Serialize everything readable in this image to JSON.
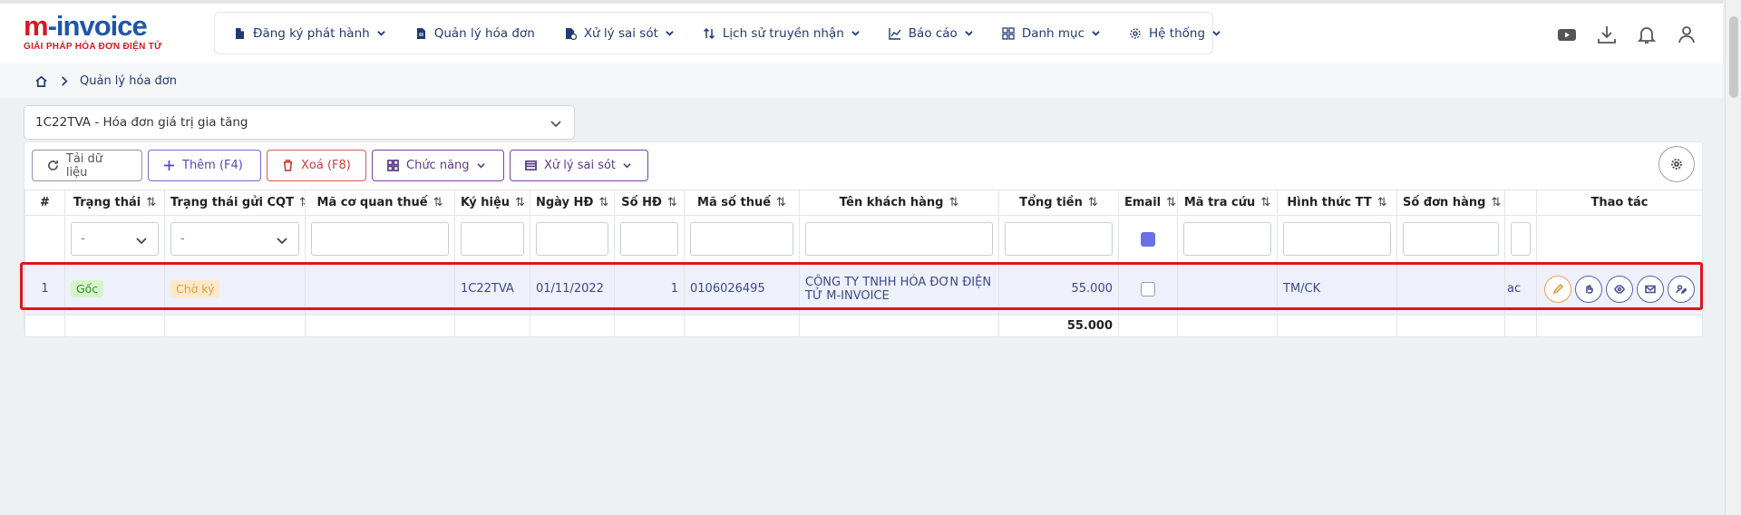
{
  "logo": {
    "main_m": "m",
    "main_rest": "-invoice",
    "tagline": "GIẢI PHÁP HÓA ĐƠN ĐIỆN TỬ"
  },
  "nav": [
    {
      "label": "Đăng ký phát hành",
      "icon": "file-icon",
      "dropdown": true
    },
    {
      "label": "Quản lý hóa đơn",
      "icon": "document-icon",
      "dropdown": false
    },
    {
      "label": "Xử lý sai sót",
      "icon": "file-error-icon",
      "dropdown": true
    },
    {
      "label": "Lịch sử truyền nhận",
      "icon": "sort-arrows-icon",
      "dropdown": true
    },
    {
      "label": "Báo cáo",
      "icon": "chart-icon",
      "dropdown": true
    },
    {
      "label": "Danh mục",
      "icon": "grid-icon",
      "dropdown": true
    },
    {
      "label": "Hệ thống",
      "icon": "gear-icon",
      "dropdown": true
    }
  ],
  "breadcrumb": {
    "current": "Quản lý hóa đơn"
  },
  "series_select": {
    "value": "1C22TVA - Hóa đơn giá trị gia tăng"
  },
  "toolbar": {
    "reload": "Tải dữ liệu",
    "add": "Thêm (F4)",
    "delete": "Xoá (F8)",
    "functions": "Chức năng",
    "error_handling": "Xử lý sai sót"
  },
  "table": {
    "headers": {
      "index": "#",
      "status": "Trạng thái",
      "cqt_status": "Trạng thái gửi CQT",
      "tax_code_agency": "Mã cơ quan thuế",
      "symbol": "Ký hiệu",
      "date": "Ngày HĐ",
      "number": "Số HĐ",
      "tax_code": "Mã số thuế",
      "customer": "Tên khách hàng",
      "total": "Tổng tiền",
      "email": "Email",
      "lookup": "Mã tra cứu",
      "payment": "Hình thức TT",
      "order_no": "Số đơn hàng",
      "actions": "Thao tác"
    },
    "filters": {
      "status": "-",
      "cqt_status": "-"
    },
    "rows": [
      {
        "index": "1",
        "status": "Gốc",
        "cqt_status": "Chờ ký",
        "tax_code_agency": "",
        "symbol": "1C22TVA",
        "date": "01/11/2022",
        "number": "1",
        "tax_code": "0106026495",
        "customer": "CÔNG TY TNHH HÓA ĐƠN ĐIỆN TỬ M-INVOICE",
        "total": "55.000",
        "lookup": "",
        "payment": "TM/CK",
        "order_no": "",
        "extra": "ac"
      }
    ],
    "footer_total": "55.000"
  },
  "colors": {
    "accent": "#1f3b73",
    "brand_red": "#d71920",
    "brand_blue": "#1f57a8",
    "highlight": "#e0151a"
  }
}
